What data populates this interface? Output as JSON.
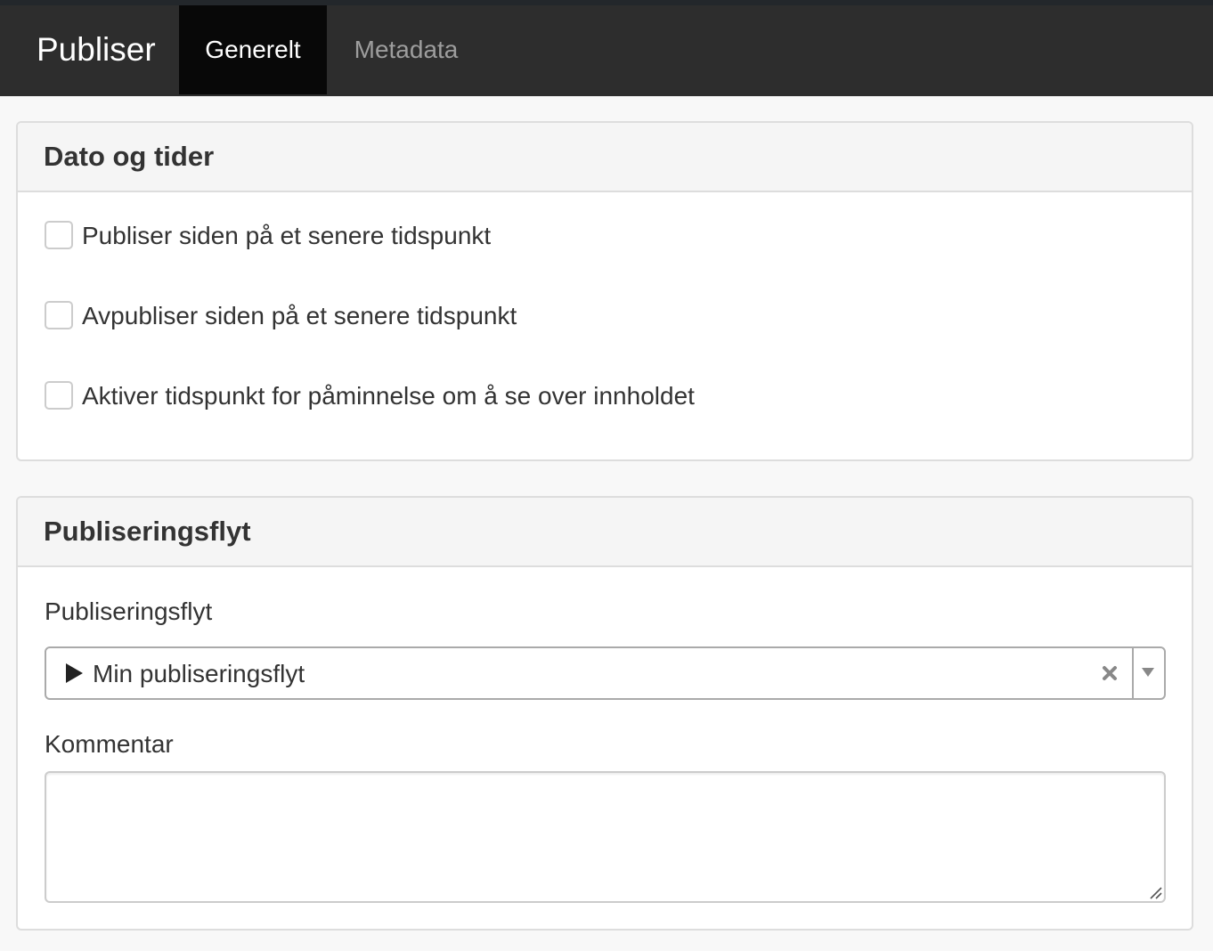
{
  "header": {
    "brand": "Publiser",
    "tabs": [
      {
        "label": "Generelt",
        "active": true
      },
      {
        "label": "Metadata",
        "active": false
      }
    ]
  },
  "dates_panel": {
    "title": "Dato og tider",
    "checkboxes": [
      {
        "label": "Publiser siden på et senere tidspunkt",
        "checked": false
      },
      {
        "label": "Avpubliser siden på et senere tidspunkt",
        "checked": false
      },
      {
        "label": "Aktiver tidspunkt for påminnelse om å se over innholdet",
        "checked": false
      }
    ]
  },
  "workflow_panel": {
    "title": "Publiseringsflyt",
    "workflow_label": "Publiseringsflyt",
    "workflow_value": "Min publiseringsflyt",
    "comment_label": "Kommentar",
    "comment_value": ""
  },
  "colors": {
    "navbar": "#2d2d2d",
    "active_tab": "#080808",
    "inactive_tab_text": "#9d9d9d",
    "panel_heading": "#f5f5f5",
    "border": "#dddddd"
  },
  "icons": [
    "play-icon",
    "clear-icon",
    "chevron-down-icon",
    "resize-handle-icon"
  ]
}
